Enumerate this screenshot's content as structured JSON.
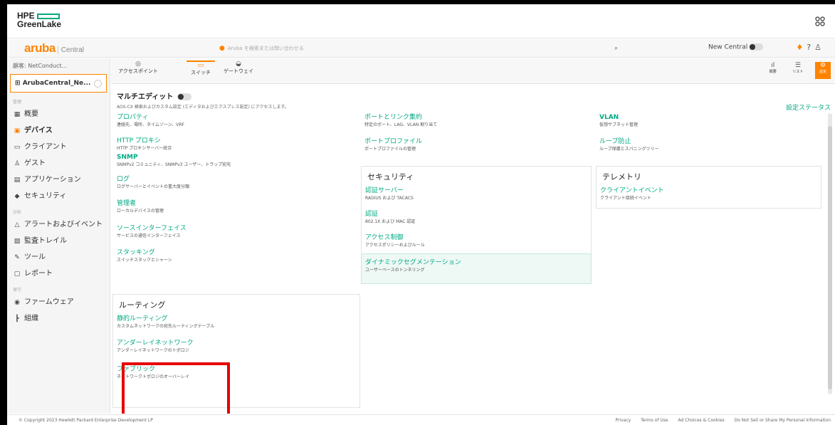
{
  "hpe": {
    "logo_line1": "HPE",
    "logo_line2": "GreenLake",
    "apps_icon": "apps-grid-icon"
  },
  "aruba": {
    "brand": "aruba",
    "product": "Central",
    "search_placeholder": "Aruba を検索または問い合わせる",
    "new_central_label": "New Central"
  },
  "sidebar": {
    "customer": "顧客: NetConduct...",
    "scope": "ArubaCentral_Ne...",
    "sections": {
      "manage": "管理",
      "analyze": "分析",
      "maintain": "保守"
    },
    "items": [
      {
        "label": "概要",
        "icon": "overview-icon"
      },
      {
        "label": "デバイス",
        "icon": "device-icon"
      },
      {
        "label": "クライアント",
        "icon": "client-icon"
      },
      {
        "label": "ゲスト",
        "icon": "guest-icon"
      },
      {
        "label": "アプリケーション",
        "icon": "application-icon"
      },
      {
        "label": "セキュリティ",
        "icon": "security-icon"
      },
      {
        "label": "アラートおよびイベント",
        "icon": "alert-icon"
      },
      {
        "label": "監査トレイル",
        "icon": "audit-icon"
      },
      {
        "label": "ツール",
        "icon": "tools-icon"
      },
      {
        "label": "レポート",
        "icon": "report-icon"
      },
      {
        "label": "ファームウェア",
        "icon": "firmware-icon"
      },
      {
        "label": "組織",
        "icon": "organization-icon"
      }
    ]
  },
  "tabs": [
    {
      "label": "アクセスポイント"
    },
    {
      "label": "スイッチ"
    },
    {
      "label": "ゲートウェイ"
    }
  ],
  "view": {
    "summary": "概要",
    "list": "リスト",
    "config": "設定"
  },
  "content": {
    "multi_edit": "マルチエディット",
    "multi_edit_desc": "AOS-CX 検索およびカスタム設定 (エディタおよびエクスプレス設定) にアクセスします。",
    "config_status": "設定ステータス",
    "col1": [
      {
        "title": "プロパティ",
        "desc": "連絡先、場所、タイムゾーン、VRF"
      },
      {
        "title": "HTTP プロキシ",
        "desc": "HTTP プロキシサーバー統合"
      },
      {
        "title": "SNMP",
        "desc": "SNMPv2 コミュニティ、SNMPv3 ユーザー、トラップ宛先"
      },
      {
        "title": "ログ",
        "desc": "ログサーバーとイベントの重大度分類"
      },
      {
        "title": "管理者",
        "desc": "ローカルデバイスの管理"
      },
      {
        "title": "ソースインターフェイス",
        "desc": "サービスの通信インターフェイス"
      },
      {
        "title": "スタッキング",
        "desc": "スイッチスタックとシャーシ"
      }
    ],
    "routing": {
      "heading": "ルーティング",
      "items": [
        {
          "title": "静的ルーティング",
          "desc": "カスタムネットワークの宛先ルーティングテーブル"
        },
        {
          "title": "アンダーレイネットワーク",
          "desc": "アンダーレイネットワークのトポロジ"
        },
        {
          "title": "ファブリック",
          "desc": "ネットワークトポロジのオーバーレイ"
        }
      ]
    },
    "col2": [
      {
        "title": "ポートとリンク集約",
        "desc": "特定のポート、LAG、VLAN 割り当て"
      },
      {
        "title": "ポートプロファイル",
        "desc": "ポートプロファイルの管理"
      }
    ],
    "security": {
      "heading": "セキュリティ",
      "items": [
        {
          "title": "認証サーバー",
          "desc": "RADIUS および TACACS"
        },
        {
          "title": "認証",
          "desc": "802.1X および MAC 認証"
        },
        {
          "title": "アクセス制御",
          "desc": "アクセスポリシーおよびルール"
        },
        {
          "title": "ダイナミックセグメンテーション",
          "desc": "ユーザーベースのトンネリング"
        }
      ]
    },
    "col3": [
      {
        "title": "VLAN",
        "desc": "仮想サブネット管理"
      },
      {
        "title": "ループ防止",
        "desc": "ループ保護とスパニングツリー"
      }
    ],
    "telemetry": {
      "heading": "テレメトリ",
      "items": [
        {
          "title": "クライアントイベント",
          "desc": "クライアント接続イベント"
        }
      ]
    }
  },
  "footer": {
    "copyright": "© Copyright 2023 Hewlett Packard Enterprise Development LP",
    "links": [
      "Privacy",
      "Terms of Use",
      "Ad Choices & Cookies",
      "Do Not Sell or Share My Personal Information"
    ]
  },
  "colors": {
    "accent": "#ff8300",
    "link": "#01a982",
    "highlight_box": "#e50000"
  }
}
